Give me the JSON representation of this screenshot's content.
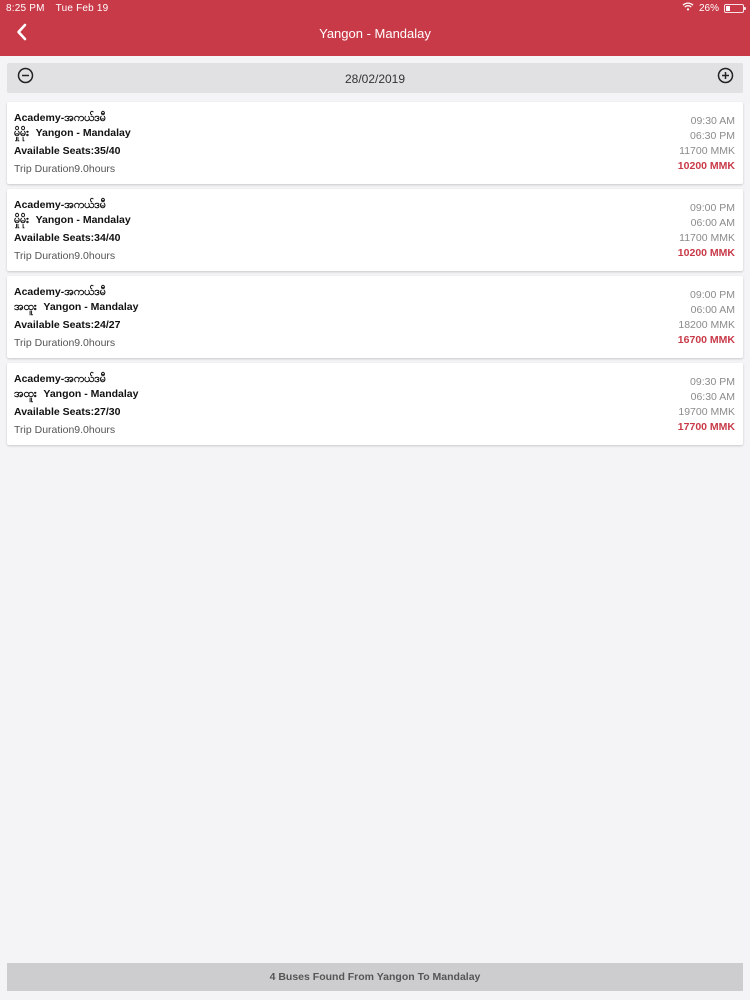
{
  "status_bar": {
    "time": "8:25 PM",
    "date": "Tue Feb 19",
    "battery": "26%",
    "battery_level": 0.26
  },
  "header": {
    "title": "Yangon - Mandalay"
  },
  "date_selector": {
    "date": "28/02/2019"
  },
  "trips": [
    {
      "operator": "Academy-အကယ်ဒမီ",
      "bus_type": "မှိုမိုး",
      "route": "Yangon - Mandalay",
      "seats": "Available Seats:35/40",
      "duration": "Trip Duration9.0hours",
      "departure": "09:30 AM",
      "arrival": "06:30 PM",
      "price": "11700 MMK",
      "discount_price": "10200 MMK"
    },
    {
      "operator": "Academy-အကယ်ဒမီ",
      "bus_type": "မှိုမိုး",
      "route": "Yangon - Mandalay",
      "seats": "Available Seats:34/40",
      "duration": "Trip Duration9.0hours",
      "departure": "09:00 PM",
      "arrival": "06:00 AM",
      "price": "11700 MMK",
      "discount_price": "10200 MMK"
    },
    {
      "operator": "Academy-အကယ်ဒမီ",
      "bus_type": "အထူး",
      "route": "Yangon - Mandalay",
      "seats": "Available Seats:24/27",
      "duration": "Trip Duration9.0hours",
      "departure": "09:00 PM",
      "arrival": "06:00 AM",
      "price": "18200 MMK",
      "discount_price": "16700 MMK"
    },
    {
      "operator": "Academy-အကယ်ဒမီ",
      "bus_type": "အထူး",
      "route": "Yangon - Mandalay",
      "seats": "Available Seats:27/30",
      "duration": "Trip Duration9.0hours",
      "departure": "09:30 PM",
      "arrival": "06:30 AM",
      "price": "19700 MMK",
      "discount_price": "17700 MMK"
    }
  ],
  "footer": {
    "summary": "4 Buses Found From Yangon To Mandalay"
  },
  "colors": {
    "brand": "#c93a49",
    "background": "#f4f4f6",
    "secondary_text": "#8b8b8b"
  },
  "icons": {
    "back": "chevron-left-icon",
    "previous_date": "circle-minus-icon",
    "next_date": "circle-plus-icon",
    "wifi": "wifi-icon",
    "battery": "battery-icon"
  }
}
